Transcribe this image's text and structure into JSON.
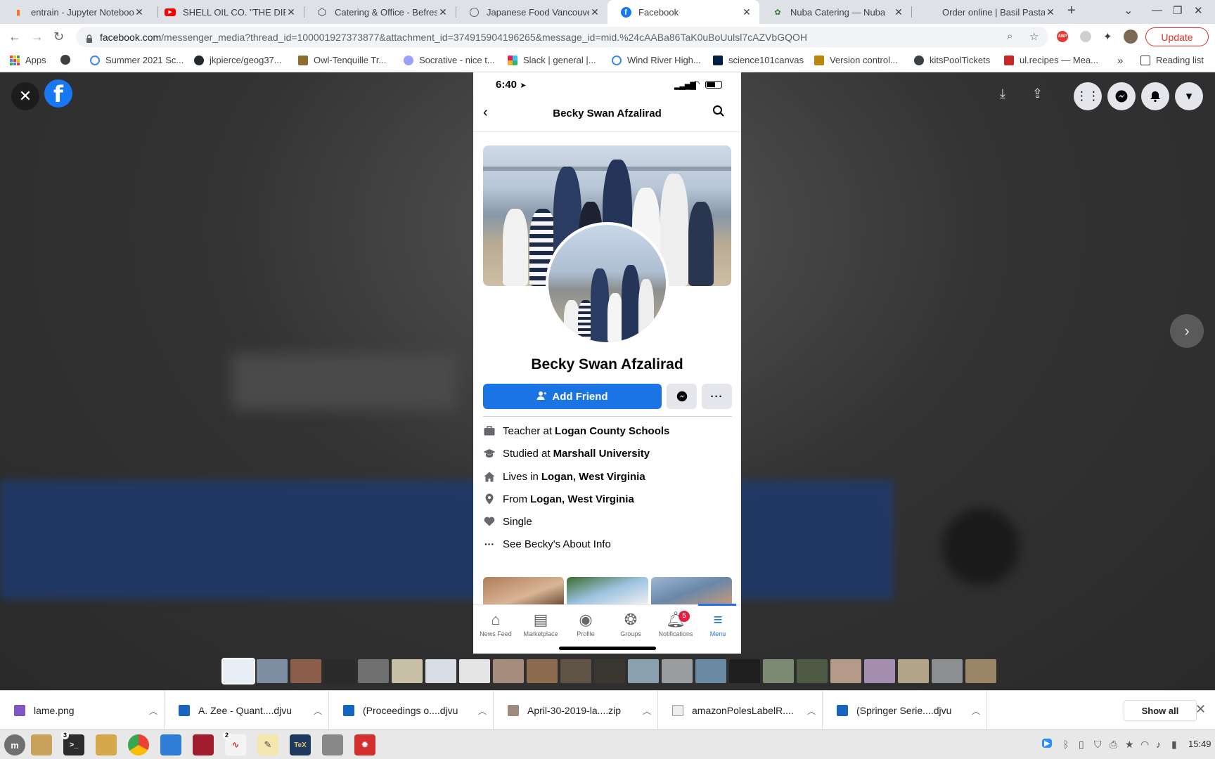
{
  "browser": {
    "tabs": [
      {
        "title": "entrain - Jupyter Noteboo"
      },
      {
        "title": "SHELL OIL CO. \"THE DIESE"
      },
      {
        "title": "Catering & Office - Befres"
      },
      {
        "title": "Japanese Food Vancouve"
      },
      {
        "title": "Facebook"
      },
      {
        "title": "Nuba Catering — Nuba"
      },
      {
        "title": "Order online | Basil Pasta"
      }
    ],
    "url_host": "facebook.com",
    "url_rest": "/messenger_media?thread_id=100001927373877&attachment_id=374915904196265&message_id=mid.%24cAABa86TaK0uBoUulsl7cAZVbGQOH",
    "update_label": "Update",
    "bookmarks": [
      "Apps",
      "Summer 2021 Sc...",
      "jkpierce/geog37...",
      "Owl-Tenquille Tr...",
      "Socrative - nice t...",
      "Slack | general |...",
      "Wind River High...",
      "science101canvas",
      "Version control...",
      "kitsPoolTickets",
      "ul.recipes — Mea...",
      "Reading list"
    ],
    "bookmarks_overflow": "»"
  },
  "phone": {
    "time": "6:40",
    "header_name": "Becky Swan Afzalirad",
    "profile_name": "Becky Swan Afzalirad",
    "add_friend_label": "Add Friend",
    "more_label": "···",
    "info": [
      {
        "prefix": "Teacher at",
        "value": "Logan County Schools",
        "icon": "briefcase-icon"
      },
      {
        "prefix": "Studied at",
        "value": "Marshall University",
        "icon": "graduation-cap-icon"
      },
      {
        "prefix": "Lives in",
        "value": "Logan, West Virginia",
        "icon": "home-icon"
      },
      {
        "prefix": "From",
        "value": "Logan, West Virginia",
        "icon": "location-pin-icon"
      },
      {
        "prefix": "",
        "value": "Single",
        "icon": "heart-icon"
      },
      {
        "prefix": "",
        "value": "See Becky's About Info",
        "icon": "more-dots-icon"
      }
    ],
    "tabbar": [
      {
        "label": "News Feed",
        "icon": "home-icon"
      },
      {
        "label": "Marketplace",
        "icon": "store-icon"
      },
      {
        "label": "Profile",
        "icon": "profile-icon"
      },
      {
        "label": "Groups",
        "icon": "groups-icon"
      },
      {
        "label": "Notifications",
        "icon": "bell-icon"
      },
      {
        "label": "Menu",
        "icon": "menu-icon"
      }
    ],
    "notifications_badge": "5",
    "active_tab": "Menu"
  },
  "downloads": [
    {
      "name": "lame.png"
    },
    {
      "name": "A. Zee - Quant....djvu"
    },
    {
      "name": "(Proceedings o....djvu"
    },
    {
      "name": "April-30-2019-la....zip"
    },
    {
      "name": "amazonPolesLabelR...."
    },
    {
      "name": "(Springer Serie....djvu"
    }
  ],
  "downloads_show_all": "Show all",
  "taskbar": {
    "terminal_badge": "3",
    "app_badge": "2",
    "clock": "15:49"
  },
  "colors": {
    "facebook_blue": "#1877f2",
    "add_friend_blue": "#1b74e4",
    "badge_red": "#e41e3f",
    "update_red": "#d93025"
  }
}
